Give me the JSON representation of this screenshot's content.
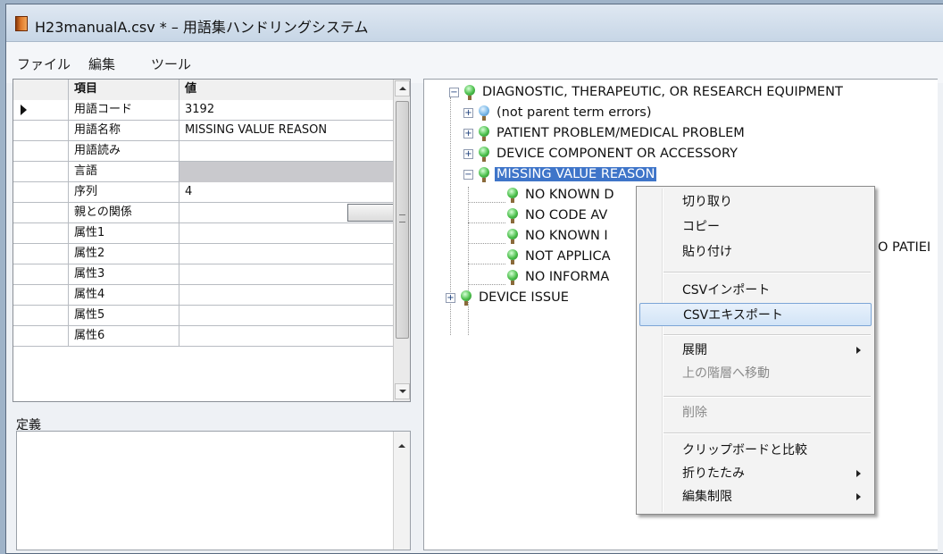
{
  "window": {
    "title": "H23manualA.csv *  –  用語集ハンドリングシステム"
  },
  "menu": [
    "ファイル",
    "編集",
    "ツール"
  ],
  "grid": {
    "headers": [
      "項目",
      "値"
    ],
    "rows": [
      {
        "field": "用語コード",
        "value": "3192"
      },
      {
        "field": "用語名称",
        "value": "MISSING VALUE REASON"
      },
      {
        "field": "用語読み",
        "value": ""
      },
      {
        "field": "言語",
        "value": ""
      },
      {
        "field": "序列",
        "value": "4"
      },
      {
        "field": "親との関係",
        "value": ""
      },
      {
        "field": "属性1",
        "value": ""
      },
      {
        "field": "属性2",
        "value": ""
      },
      {
        "field": "属性3",
        "value": ""
      },
      {
        "field": "属性4",
        "value": ""
      },
      {
        "field": "属性5",
        "value": ""
      },
      {
        "field": "属性6",
        "value": ""
      }
    ]
  },
  "definition": {
    "label": "定義",
    "value": ""
  },
  "tree": {
    "root": "DIAGNOSTIC, THERAPEUTIC, OR RESEARCH EQUIPMENT",
    "children": [
      "(not parent term errors)",
      "PATIENT PROBLEM/MEDICAL PROBLEM",
      "DEVICE COMPONENT OR ACCESSORY",
      "MISSING VALUE REASON",
      "DEVICE ISSUE"
    ],
    "selected_children": [
      "NO KNOWN D",
      "NO CODE AV",
      "NO KNOWN I",
      "NOT APPLICA",
      "NO INFORMA"
    ],
    "overflow_text": "O PATIEI"
  },
  "context_menu": {
    "items": [
      {
        "label": "切り取り",
        "enabled": true
      },
      {
        "label": "コピー",
        "enabled": true
      },
      {
        "label": "貼り付け",
        "enabled": true
      },
      {
        "label": "CSVインポート",
        "enabled": true
      },
      {
        "label": "CSVエキスポート",
        "enabled": true,
        "highlighted": true
      },
      {
        "label": "展開",
        "enabled": true,
        "submenu": true
      },
      {
        "label": "上の階層へ移動",
        "enabled": false
      },
      {
        "label": "削除",
        "enabled": false
      },
      {
        "label": "クリップボードと比較",
        "enabled": true
      },
      {
        "label": "折りたたみ",
        "enabled": true,
        "submenu": true
      },
      {
        "label": "編集制限",
        "enabled": true,
        "submenu": true
      }
    ]
  },
  "colors": {
    "selection": "#3f75c9",
    "menu_highlight": "#d2e4f7",
    "node_bulb": "#4bbf4b"
  }
}
